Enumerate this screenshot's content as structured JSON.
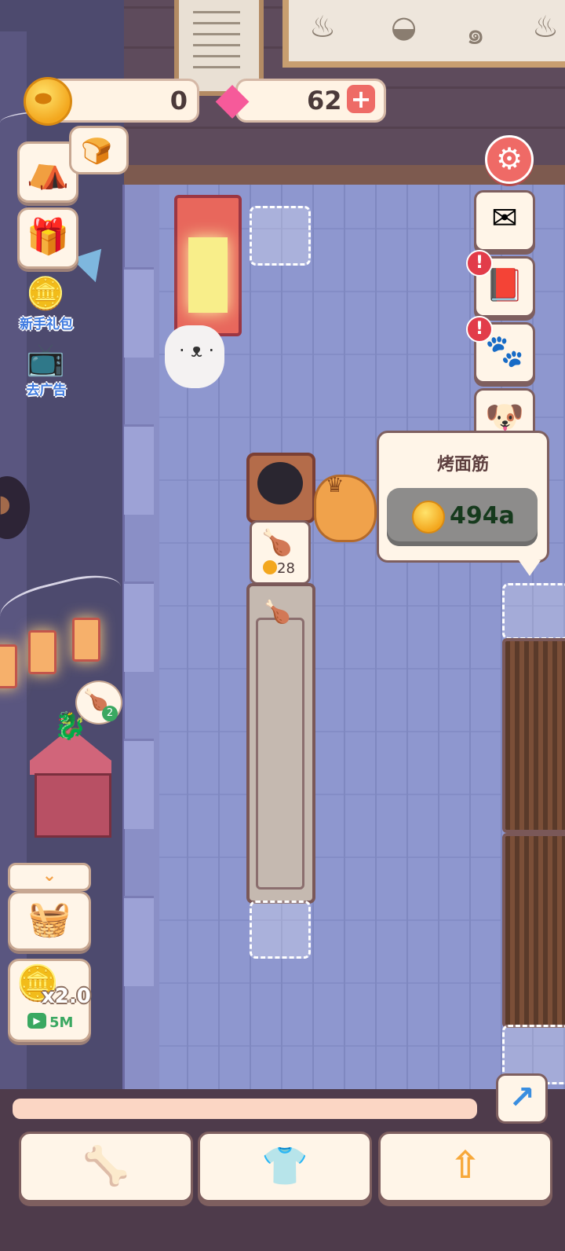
{
  "hud": {
    "coins": "0",
    "gems": "62"
  },
  "popup": {
    "dish_name": "烤面筋",
    "price": "494a"
  },
  "side_labels": {
    "newbie_pack": "新手礼包",
    "remove_ads": "去广告"
  },
  "boost": {
    "multiplier": "x2.0",
    "duration": "5M"
  },
  "station": {
    "dish_count": "28",
    "shrine_count": "2"
  },
  "icons": {
    "coin": "coin-icon",
    "gem": "gem-icon",
    "settings": "gear-icon",
    "mail": "envelope-icon",
    "album": "photo-album-icon",
    "paw": "paw-icon",
    "dog_avatar": "dog-avatar-icon",
    "bone": "bone-icon",
    "shirt": "shirt-icon",
    "upgrade": "arrow-up-icon",
    "trend": "trend-arrow-icon"
  },
  "colors": {
    "accent_red": "#ef6a66",
    "gem_pink": "#f65a9a",
    "coin_gold": "#f3a71e",
    "panel_cream": "#fff5e8",
    "floor_blue": "#8e97cf",
    "label_blue": "#3f7be0",
    "price_green": "#163a1d"
  }
}
